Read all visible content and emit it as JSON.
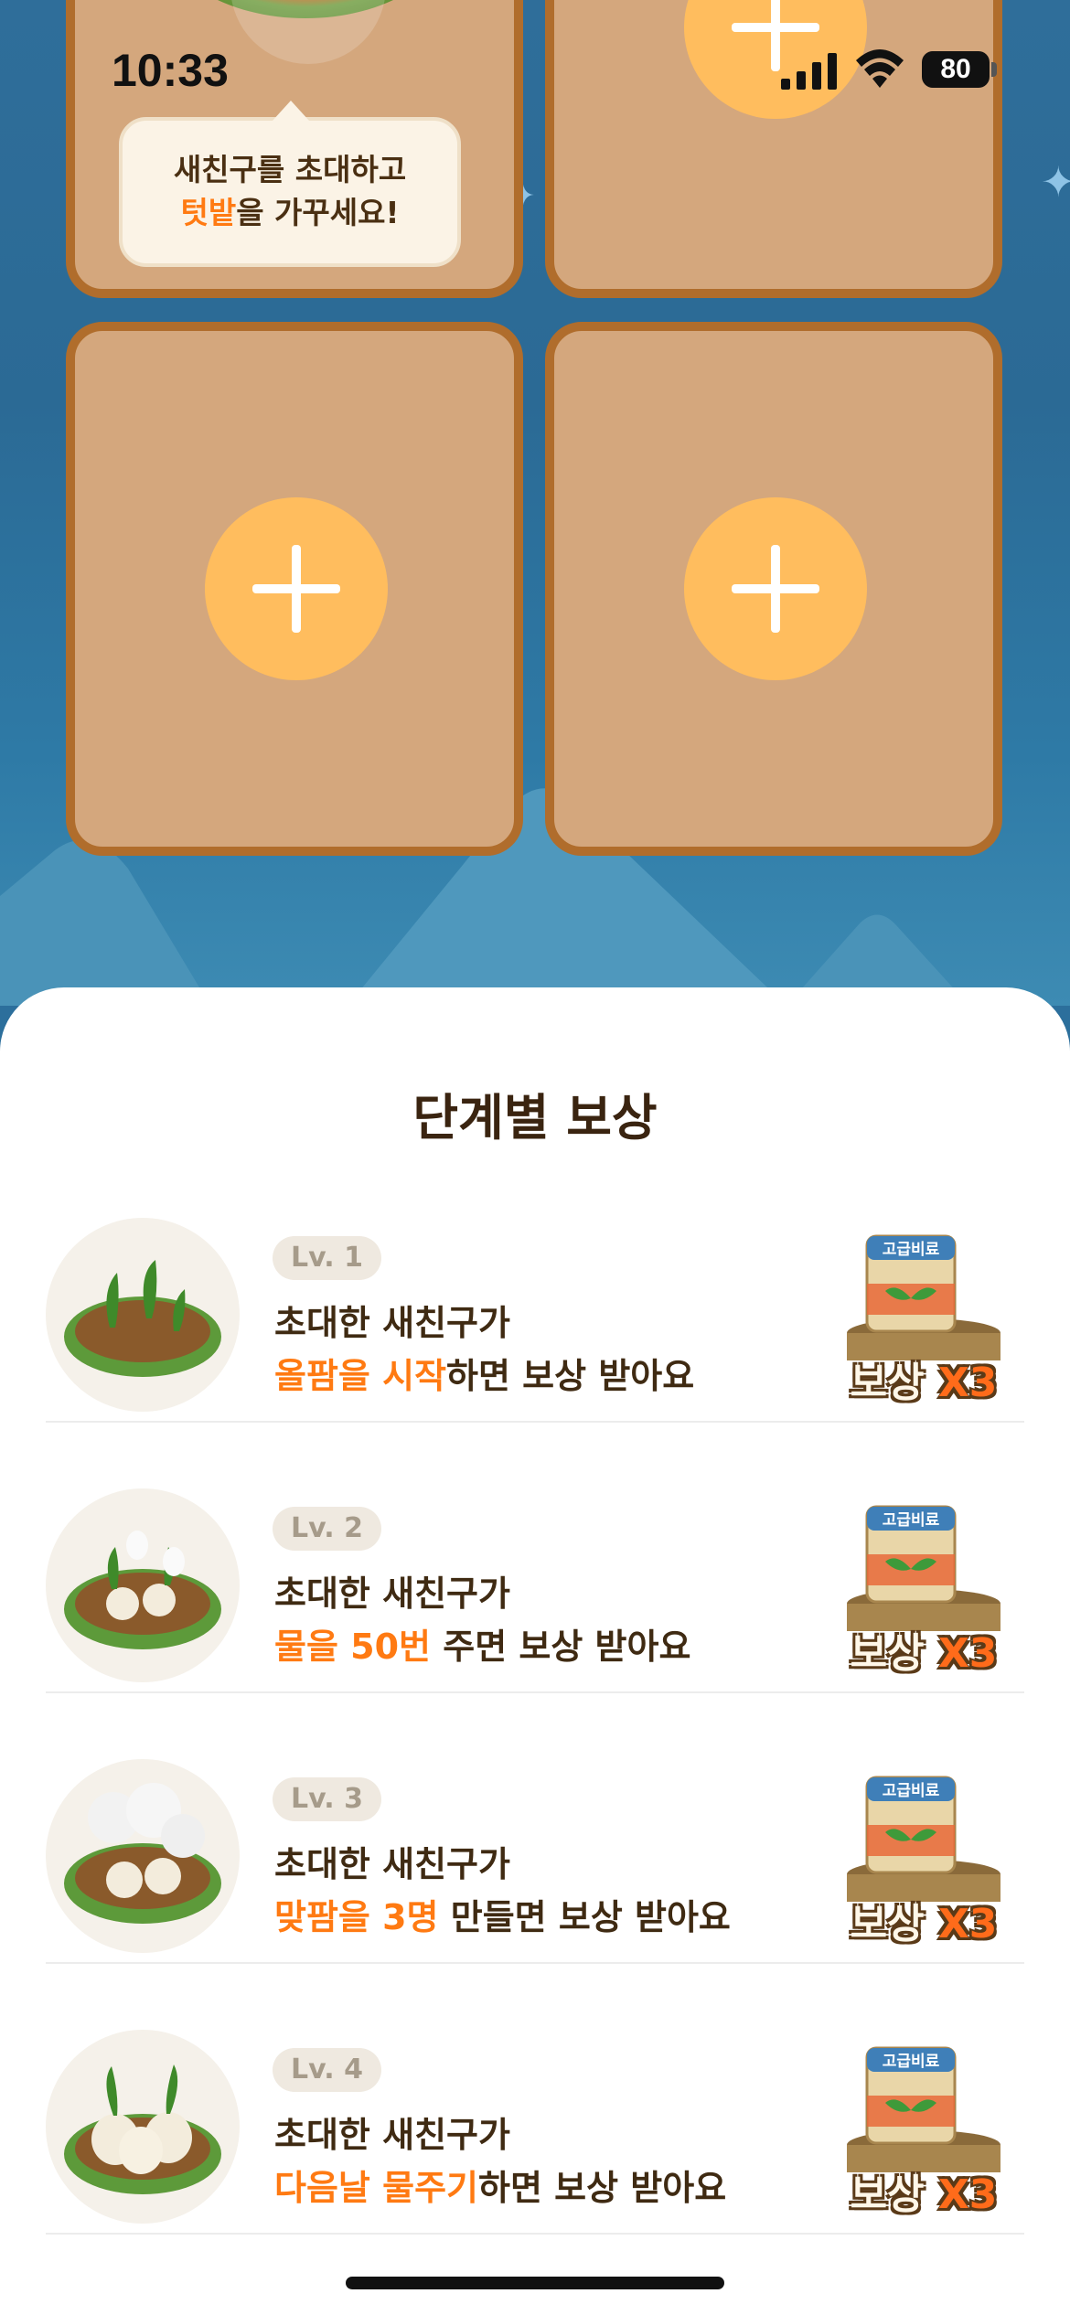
{
  "status_bar": {
    "time": "10:33",
    "battery": "80"
  },
  "plots": {
    "tooltip_line1": "새친구를 초대하고",
    "tooltip_highlight": "텃밭",
    "tooltip_rest": "을 가꾸세요!"
  },
  "sheet": {
    "title": "단계별 보상",
    "rows": [
      {
        "level": "Lv. 1",
        "line1": "초대한 새친구가",
        "highlight": "올팜을 시작",
        "rest": "하면 보상 받아요",
        "reward_item": "고급비료",
        "reward_label": "보상",
        "reward_count": "X3"
      },
      {
        "level": "Lv. 2",
        "line1": "초대한 새친구가",
        "highlight": "물을 50번",
        "rest": " 주면 보상 받아요",
        "reward_item": "고급비료",
        "reward_label": "보상",
        "reward_count": "X3"
      },
      {
        "level": "Lv. 3",
        "line1": "초대한 새친구가",
        "highlight": "맞팜을 3명",
        "rest": " 만들면 보상 받아요",
        "reward_item": "고급비료",
        "reward_label": "보상",
        "reward_count": "X3"
      },
      {
        "level": "Lv. 4",
        "line1": "초대한 새친구가",
        "highlight": "다음날 물주기",
        "rest": "하면 보상 받아요",
        "reward_item": "고급비료",
        "reward_label": "보상",
        "reward_count": "X3"
      }
    ]
  }
}
